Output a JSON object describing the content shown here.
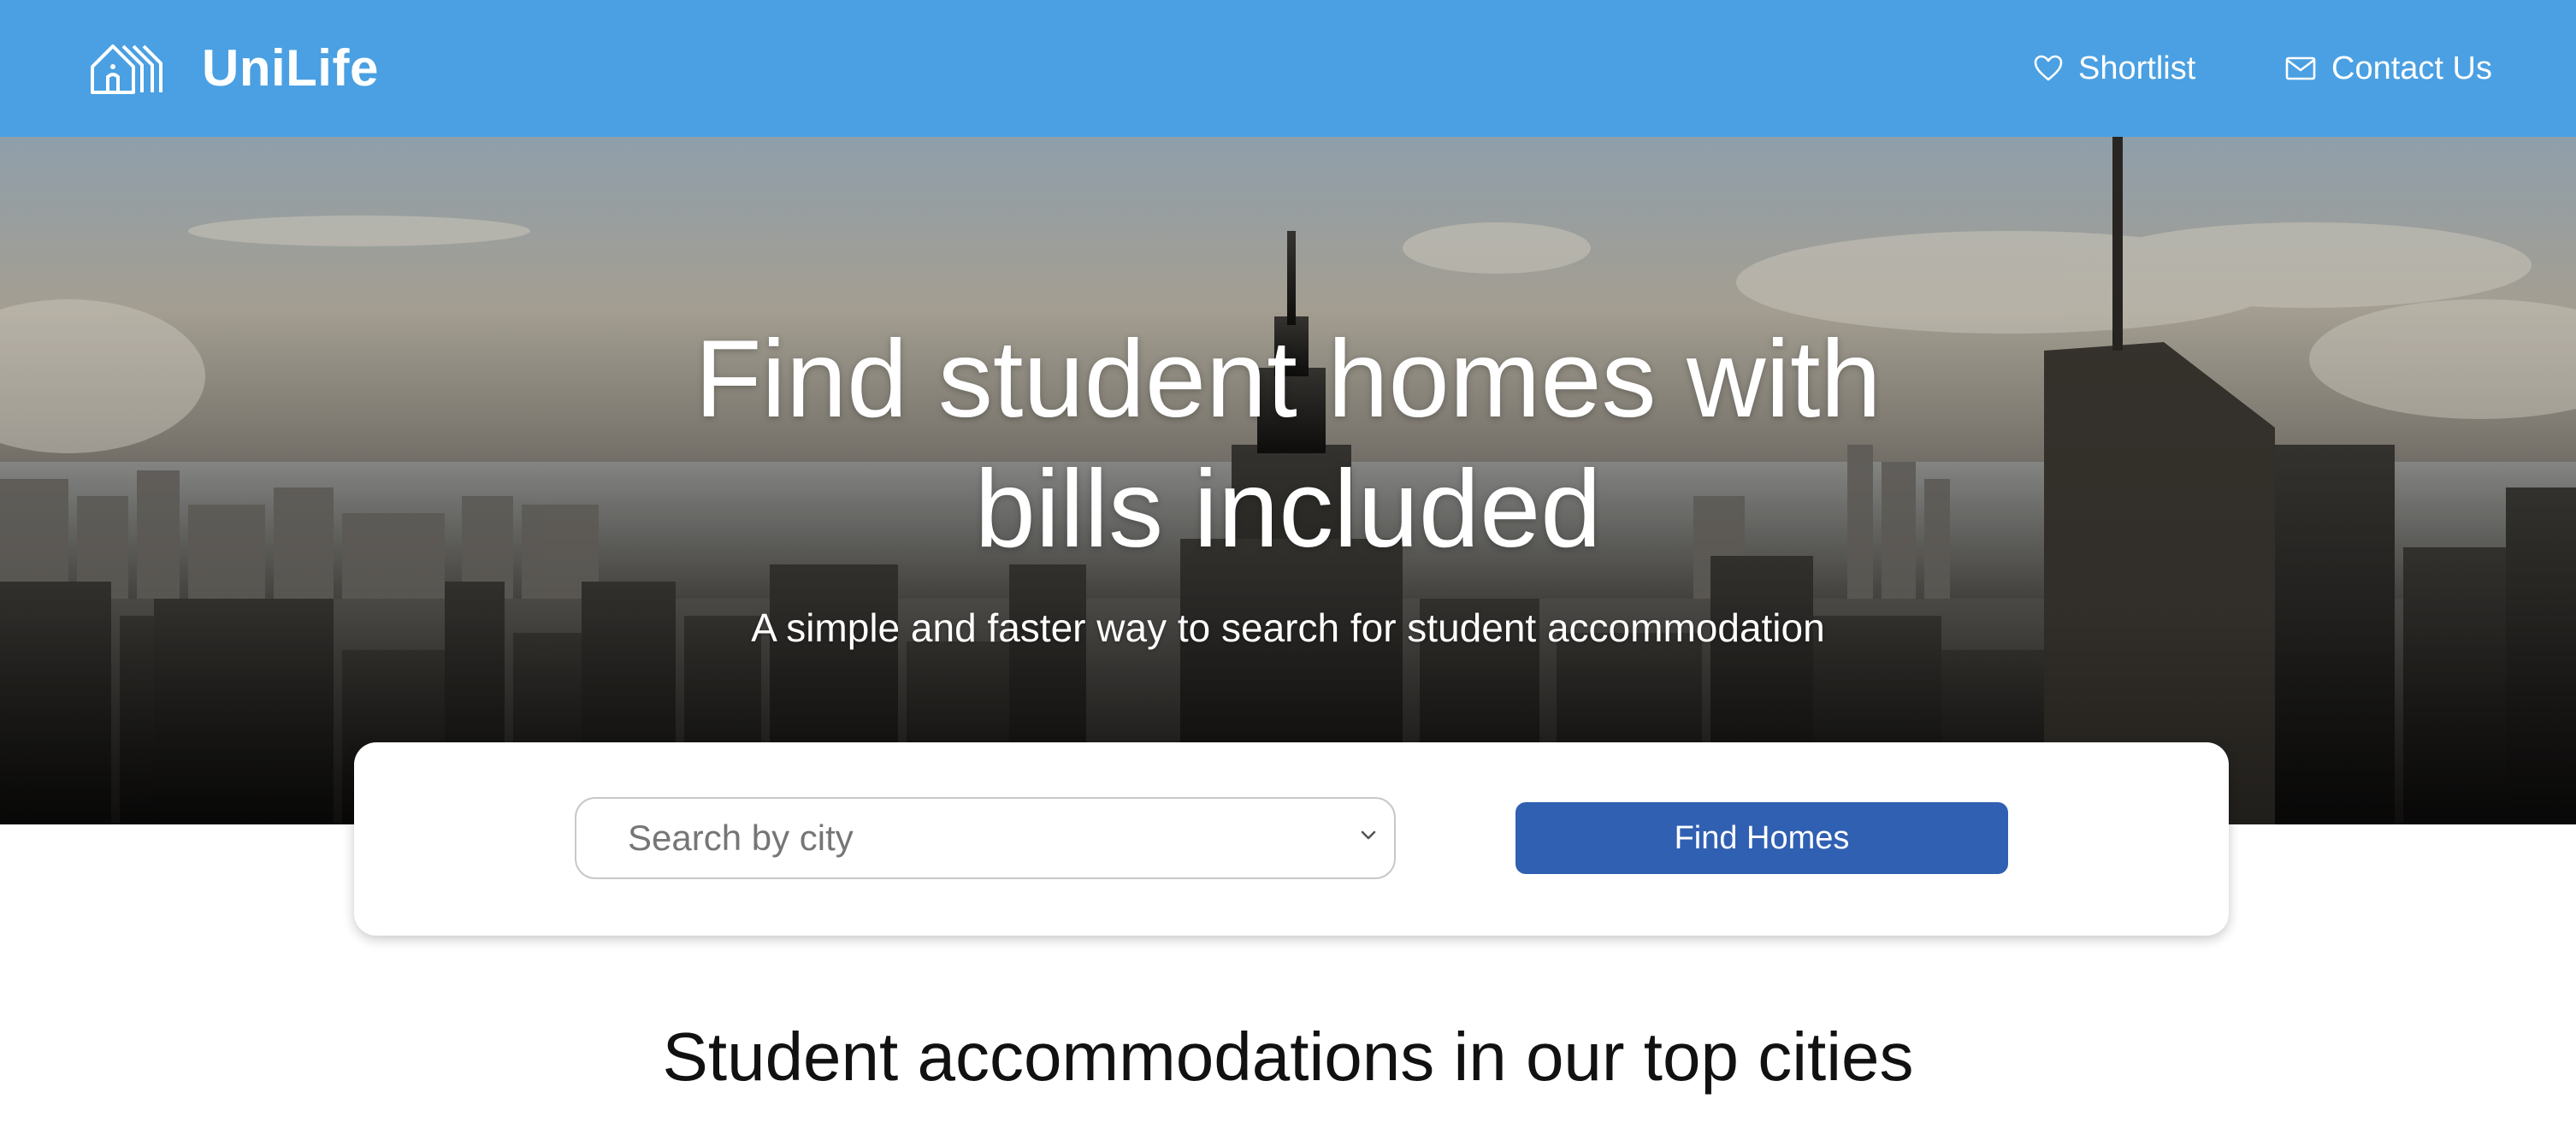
{
  "header": {
    "brand": "UniLife",
    "logo_icon": "house-logo-icon",
    "nav": [
      {
        "label": "Shortlist",
        "icon": "heart-icon"
      },
      {
        "label": "Contact Us",
        "icon": "mail-icon"
      }
    ],
    "background_color": "#4aa0e2"
  },
  "hero": {
    "title_line1": "Find student homes with",
    "title_line2": "bills included",
    "subtitle": "A simple and faster way to search for student accommodation",
    "background_image": "city-skyline"
  },
  "search": {
    "city_select": {
      "placeholder": "Search by city",
      "icon": "chevron-down-icon"
    },
    "button_label": "Find Homes",
    "button_color": "#3060b2"
  },
  "main": {
    "section_title": "Student accommodations in our top cities"
  }
}
